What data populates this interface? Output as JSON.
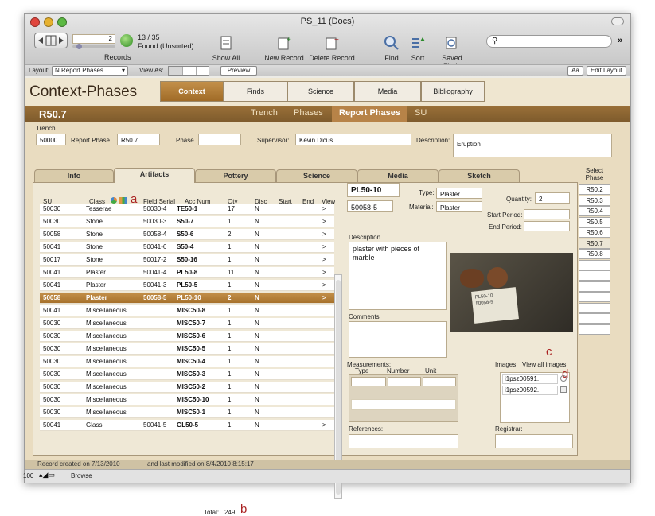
{
  "window": {
    "title": "PS_11 (Docs)"
  },
  "toolbar": {
    "record_value": "2",
    "found_count": "13 / 35",
    "found_label": "Found (Unsorted)",
    "records_label": "Records",
    "show_all": "Show All",
    "new_record": "New Record",
    "delete_record": "Delete Record",
    "find": "Find",
    "sort": "Sort",
    "saved_finds": "Saved Finds",
    "search_placeholder": ""
  },
  "layoutbar": {
    "layout_label": "Layout:",
    "layout_value": "N Report Phases",
    "view_as": "View As:",
    "preview": "Preview",
    "aa": "Aa",
    "edit_layout": "Edit Layout"
  },
  "header": {
    "title": "Context-Phases",
    "tabs": [
      "Context",
      "Finds",
      "Science",
      "Media",
      "Bibliography"
    ],
    "active_tab": "Context"
  },
  "record": {
    "id": "R50.7",
    "subtabs": [
      "Trench",
      "Phases",
      "Report Phases",
      "SU"
    ],
    "active_subtab": "Report Phases"
  },
  "fields": {
    "trench_label": "Trench",
    "trench": "50000",
    "report_phase_label": "Report Phase",
    "report_phase": "R50.7",
    "phase_label": "Phase",
    "phase": "",
    "supervisor_label": "Supervisor:",
    "supervisor": "Kevin Dicus",
    "description_label": "Description:",
    "description": "Eruption"
  },
  "tabs": [
    "Info",
    "Artifacts",
    "Pottery",
    "Science",
    "Media",
    "Sketch"
  ],
  "active_tab": "Artifacts",
  "table": {
    "headers": [
      "SU",
      "Class",
      "Field Serial",
      "Acc Num",
      "Qty",
      "Disc",
      "Start",
      "End",
      "View"
    ],
    "rows": [
      [
        "50030",
        "Tesserae",
        "50030-4",
        "TE50-1",
        "17",
        "N",
        ">"
      ],
      [
        "50030",
        "Stone",
        "50030-3",
        "S50-7",
        "1",
        "N",
        ">"
      ],
      [
        "50058",
        "Stone",
        "50058-4",
        "S50-6",
        "2",
        "N",
        ">"
      ],
      [
        "50041",
        "Stone",
        "50041-6",
        "S50-4",
        "1",
        "N",
        ">"
      ],
      [
        "50017",
        "Stone",
        "50017-2",
        "S50-16",
        "1",
        "N",
        ">"
      ],
      [
        "50041",
        "Plaster",
        "50041-4",
        "PL50-8",
        "11",
        "N",
        ">"
      ],
      [
        "50041",
        "Plaster",
        "50041-3",
        "PL50-5",
        "1",
        "N",
        ">"
      ],
      [
        "50058",
        "Plaster",
        "50058-5",
        "PL50-10",
        "2",
        "N",
        ">"
      ],
      [
        "50041",
        "Miscellaneous",
        "",
        "MISC50-8",
        "1",
        "N",
        ""
      ],
      [
        "50030",
        "Miscellaneous",
        "",
        "MISC50-7",
        "1",
        "N",
        ""
      ],
      [
        "50030",
        "Miscellaneous",
        "",
        "MISC50-6",
        "1",
        "N",
        ""
      ],
      [
        "50030",
        "Miscellaneous",
        "",
        "MISC50-5",
        "1",
        "N",
        ""
      ],
      [
        "50030",
        "Miscellaneous",
        "",
        "MISC50-4",
        "1",
        "N",
        ""
      ],
      [
        "50030",
        "Miscellaneous",
        "",
        "MISC50-3",
        "1",
        "N",
        ""
      ],
      [
        "50030",
        "Miscellaneous",
        "",
        "MISC50-2",
        "1",
        "N",
        ""
      ],
      [
        "50030",
        "Miscellaneous",
        "",
        "MISC50-10",
        "1",
        "N",
        ""
      ],
      [
        "50030",
        "Miscellaneous",
        "",
        "MISC50-1",
        "1",
        "N",
        ""
      ],
      [
        "50041",
        "Glass",
        "50041-5",
        "GL50-5",
        "1",
        "N",
        ">"
      ]
    ],
    "selected_row": 7,
    "total_label": "Total:",
    "total": "249"
  },
  "detail": {
    "acc_num": "PL50-10",
    "field_serial": "50058-5",
    "type_label": "Type:",
    "type": "Plaster",
    "material_label": "Material:",
    "material": "Plaster",
    "quantity_label": "Quantity:",
    "quantity": "2",
    "start_label": "Start Period:",
    "end_label": "End Period:",
    "description_label": "Description",
    "description": "plaster with pieces of marble",
    "comments_label": "Comments",
    "measurements_label": "Measurements:",
    "m_type": "Type",
    "m_number": "Number",
    "m_unit": "Unit",
    "images_label": "Images",
    "view_all": "View all images",
    "images": [
      "i1psz00591.",
      "i1psz00592."
    ],
    "references_label": "References:",
    "registrar_label": "Registrar:",
    "photo_labels": [
      "PL50-10",
      "50058-5"
    ]
  },
  "select_phase": {
    "label": "Select Phase",
    "items": [
      "R50.2",
      "R50.3",
      "R50.4",
      "R50.5",
      "R50.6",
      "R50.7",
      "R50.8"
    ],
    "selected": "R50.7"
  },
  "annotations": [
    "a",
    "b",
    "c",
    "d"
  ],
  "status": {
    "created": "Record created on 7/13/2010",
    "modified": "and last modified on 8/4/2010 8:15:17"
  },
  "bottom": {
    "zoom": "100",
    "mode": "Browse"
  }
}
